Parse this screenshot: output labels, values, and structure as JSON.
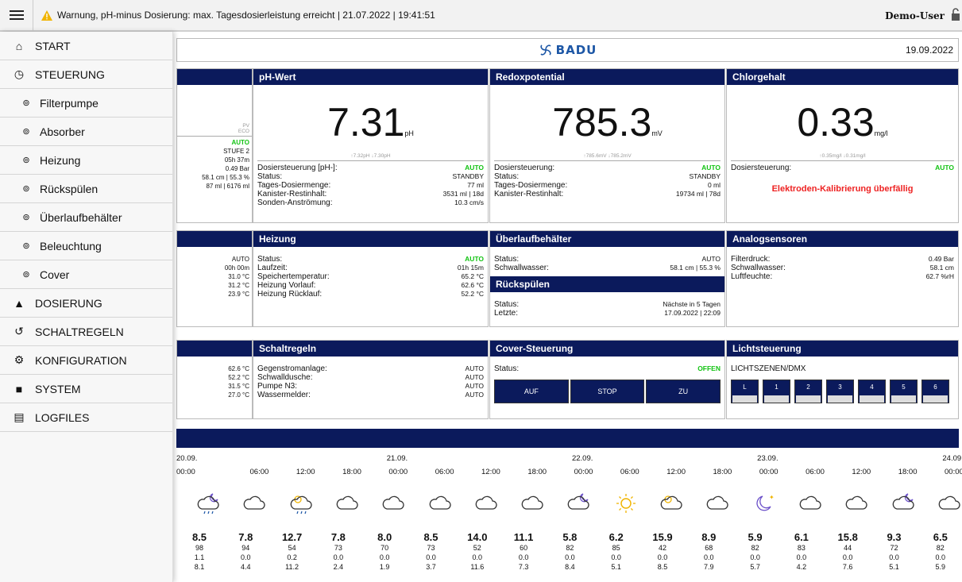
{
  "topbar": {
    "warning": "Warnung, pH-minus Dosierung: max. Tagesdosierleistung erreicht | 21.07.2022 | 19:41:51",
    "user": "Demo-User"
  },
  "sidebar": [
    {
      "label": "START",
      "icon": "home-icon",
      "type": "top"
    },
    {
      "label": "STEUERUNG",
      "icon": "clock-icon",
      "type": "top"
    },
    {
      "label": "Filterpumpe",
      "icon": "chevron-circle-icon",
      "type": "sub"
    },
    {
      "label": "Absorber",
      "icon": "chevron-circle-icon",
      "type": "sub"
    },
    {
      "label": "Heizung",
      "icon": "chevron-circle-icon",
      "type": "sub"
    },
    {
      "label": "Rückspülen",
      "icon": "chevron-circle-icon",
      "type": "sub"
    },
    {
      "label": "Überlaufbehälter",
      "icon": "chevron-circle-icon",
      "type": "sub"
    },
    {
      "label": "Beleuchtung",
      "icon": "chevron-circle-icon",
      "type": "sub"
    },
    {
      "label": "Cover",
      "icon": "chevron-circle-icon",
      "type": "sub"
    },
    {
      "label": "DOSIERUNG",
      "icon": "flask-icon",
      "type": "top"
    },
    {
      "label": "SCHALTREGELN",
      "icon": "history-icon",
      "type": "top"
    },
    {
      "label": "KONFIGURATION",
      "icon": "gear-icon",
      "type": "top"
    },
    {
      "label": "SYSTEM",
      "icon": "file-icon",
      "type": "top"
    },
    {
      "label": "LOGFILES",
      "icon": "files-icon",
      "type": "top"
    }
  ],
  "header": {
    "logo": "BADU",
    "date": "19.09.2022"
  },
  "colors": {
    "navy": "#0b1a5c",
    "green": "#12c312",
    "red": "#e22222",
    "brand": "#1d57a6"
  },
  "left": {
    "top": {
      "pv": "PV",
      "eco": "ECO",
      "vals": [
        "AUTO",
        "STUFE 2",
        "05h 37m",
        "0.49 Bar",
        "58.1 cm | 55.3 %",
        "87 ml | 6176 ml"
      ]
    },
    "mid": [
      "AUTO",
      "00h 00m",
      "31.0 °C",
      "31.2 °C",
      "23.9 °C"
    ],
    "bot": [
      "62.6 °C",
      "52.2 °C",
      "31.5 °C",
      "27.0 °C"
    ]
  },
  "ph": {
    "title": "pH-Wert",
    "value": "7.31",
    "unit": "pH",
    "sub": "↑7.32pH ↓7.30pH",
    "rows": [
      [
        "Dosiersteuerung [pH-]:",
        "AUTO"
      ],
      [
        "Status:",
        "STANDBY"
      ],
      [
        "Tages-Dosiermenge:",
        "77 ml"
      ],
      [
        "Kanister-Restinhalt:",
        "3531 ml | 18d"
      ],
      [
        "Sonden-Anströmung:",
        "10.3 cm/s"
      ]
    ]
  },
  "redox": {
    "title": "Redoxpotential",
    "value": "785.3",
    "unit": "mV",
    "sub": "↑785.6mV ↓785.2mV",
    "rows": [
      [
        "Dosiersteuerung:",
        "AUTO"
      ],
      [
        "Status:",
        "STANDBY"
      ],
      [
        "Tages-Dosiermenge:",
        "0 ml"
      ],
      [
        "Kanister-Restinhalt:",
        "19734 ml | 78d"
      ]
    ]
  },
  "chlor": {
    "title": "Chlorgehalt",
    "value": "0.33",
    "unit": "mg/l",
    "sub": "↑0.35mg/l ↓0.31mg/l",
    "rows": [
      [
        "Dosiersteuerung:",
        "AUTO"
      ]
    ],
    "alert": "Elektroden-Kalibrierung überfällig"
  },
  "heizung": {
    "title": "Heizung",
    "rows": [
      [
        "Status:",
        "AUTO"
      ],
      [
        "Laufzeit:",
        "01h 15m"
      ],
      [
        "Speichertemperatur:",
        "65.2 °C"
      ],
      [
        "Heizung Vorlauf:",
        "62.6 °C"
      ],
      [
        "Heizung Rücklauf:",
        "52.2 °C"
      ]
    ]
  },
  "ueberlauf": {
    "title": "Überlaufbehälter",
    "rows": [
      [
        "Status:",
        "AUTO"
      ],
      [
        "Schwallwasser:",
        "58.1 cm | 55.3 %"
      ]
    ]
  },
  "rueckspuelen": {
    "title": "Rückspülen",
    "rows": [
      [
        "Status:",
        "Nächste in 5 Tagen"
      ],
      [
        "Letzte:",
        "17.09.2022 | 22:09"
      ]
    ]
  },
  "analog": {
    "title": "Analogsensoren",
    "rows": [
      [
        "Filterdruck:",
        "0.49 Bar"
      ],
      [
        "Schwallwasser:",
        "58.1 cm"
      ],
      [
        "Luftfeuchte:",
        "62.7 %rH"
      ]
    ]
  },
  "schalt": {
    "title": "Schaltregeln",
    "rows": [
      [
        "Gegenstromanlage:",
        "AUTO"
      ],
      [
        "Schwalldusche:",
        "AUTO"
      ],
      [
        "Pumpe N3:",
        "AUTO"
      ],
      [
        "Wassermelder:",
        "AUTO"
      ]
    ]
  },
  "cover": {
    "title": "Cover-Steuerung",
    "status_label": "Status:",
    "status": "OFFEN",
    "buttons": [
      "AUF",
      "STOP",
      "ZU"
    ]
  },
  "licht": {
    "title": "Lichtsteuerung",
    "subtitle": "LICHTSZENEN/DMX",
    "buttons": [
      "L",
      "1",
      "2",
      "3",
      "4",
      "5",
      "6"
    ]
  },
  "weather": [
    {
      "date": "20.09.",
      "time": "00:00",
      "icon": "night-rain-icon",
      "temp": "8.5",
      "a": "98",
      "b": "1.1",
      "c": "8.1"
    },
    {
      "date": "",
      "time": "06:00",
      "icon": "cloud-icon",
      "temp": "7.8",
      "a": "94",
      "b": "0.0",
      "c": "4.4"
    },
    {
      "date": "",
      "time": "12:00",
      "icon": "sun-rain-icon",
      "temp": "12.7",
      "a": "54",
      "b": "0.2",
      "c": "11.2"
    },
    {
      "date": "",
      "time": "18:00",
      "icon": "cloud-icon",
      "temp": "7.8",
      "a": "73",
      "b": "0.0",
      "c": "2.4"
    },
    {
      "date": "21.09.",
      "time": "00:00",
      "icon": "cloud-icon",
      "temp": "8.0",
      "a": "70",
      "b": "0.0",
      "c": "1.9"
    },
    {
      "date": "",
      "time": "06:00",
      "icon": "cloud-icon",
      "temp": "8.5",
      "a": "73",
      "b": "0.0",
      "c": "3.7"
    },
    {
      "date": "",
      "time": "12:00",
      "icon": "cloud-icon",
      "temp": "14.0",
      "a": "52",
      "b": "0.0",
      "c": "11.6"
    },
    {
      "date": "",
      "time": "18:00",
      "icon": "cloud-icon",
      "temp": "11.1",
      "a": "60",
      "b": "0.0",
      "c": "7.3"
    },
    {
      "date": "22.09.",
      "time": "00:00",
      "icon": "night-cloud-icon",
      "temp": "5.8",
      "a": "82",
      "b": "0.0",
      "c": "8.4"
    },
    {
      "date": "",
      "time": "06:00",
      "icon": "sun-icon",
      "temp": "6.2",
      "a": "85",
      "b": "0.0",
      "c": "5.1"
    },
    {
      "date": "",
      "time": "12:00",
      "icon": "sun-cloud-icon",
      "temp": "15.9",
      "a": "42",
      "b": "0.0",
      "c": "8.5"
    },
    {
      "date": "",
      "time": "18:00",
      "icon": "cloud-icon",
      "temp": "8.9",
      "a": "68",
      "b": "0.0",
      "c": "7.9"
    },
    {
      "date": "23.09.",
      "time": "00:00",
      "icon": "moon-stars-icon",
      "temp": "5.9",
      "a": "82",
      "b": "0.0",
      "c": "5.7"
    },
    {
      "date": "",
      "time": "06:00",
      "icon": "cloud-icon",
      "temp": "6.1",
      "a": "83",
      "b": "0.0",
      "c": "4.2"
    },
    {
      "date": "",
      "time": "12:00",
      "icon": "cloud-icon",
      "temp": "15.8",
      "a": "44",
      "b": "0.0",
      "c": "7.6"
    },
    {
      "date": "",
      "time": "18:00",
      "icon": "night-cloud-icon",
      "temp": "9.3",
      "a": "72",
      "b": "0.0",
      "c": "5.1"
    },
    {
      "date": "24.09.",
      "time": "00:00",
      "icon": "cloud-icon",
      "temp": "6.5",
      "a": "82",
      "b": "0.0",
      "c": "5.9"
    }
  ]
}
